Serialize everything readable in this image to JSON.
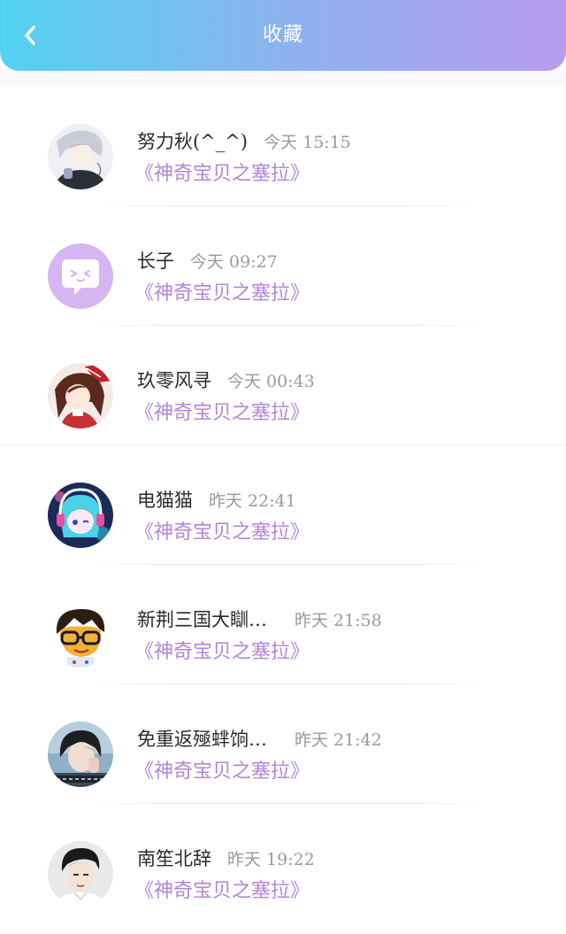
{
  "header": {
    "title": "收藏",
    "back_icon": "chevron-left-icon",
    "gradient": [
      "#52d2f1",
      "#b89cee"
    ]
  },
  "colors": {
    "link": "#b385d8",
    "name": "#2a2a2a",
    "time": "#9a9a9a"
  },
  "items": [
    {
      "name": "努力秋(^_^)",
      "time": "今天 15:15",
      "link": "《神奇宝贝之塞拉》",
      "avatar": "anime-white-hair-avatar"
    },
    {
      "name": "长子",
      "time": "今天 09:27",
      "link": "《神奇宝贝之塞拉》",
      "avatar": "chat-bubble-default-avatar"
    },
    {
      "name": "玖零风寻",
      "time": "今天 00:43",
      "link": "《神奇宝贝之塞拉》",
      "avatar": "anime-girl-red-bow-avatar"
    },
    {
      "name": "电猫猫",
      "time": "昨天 22:41",
      "link": "《神奇宝贝之塞拉》",
      "avatar": "anime-headphones-avatar"
    },
    {
      "name": "新荆三国大瞓…",
      "time": "昨天 21:58",
      "link": "《神奇宝贝之塞拉》",
      "avatar": "cartoon-glasses-avatar"
    },
    {
      "name": "免重返殛蝆饷…",
      "time": "昨天 21:42",
      "link": "《神奇宝贝之塞拉》",
      "avatar": "photo-person-avatar"
    },
    {
      "name": "南笙北辞",
      "time": "昨天 19:22",
      "link": "《神奇宝贝之塞拉》",
      "avatar": "photo-man-avatar"
    }
  ]
}
